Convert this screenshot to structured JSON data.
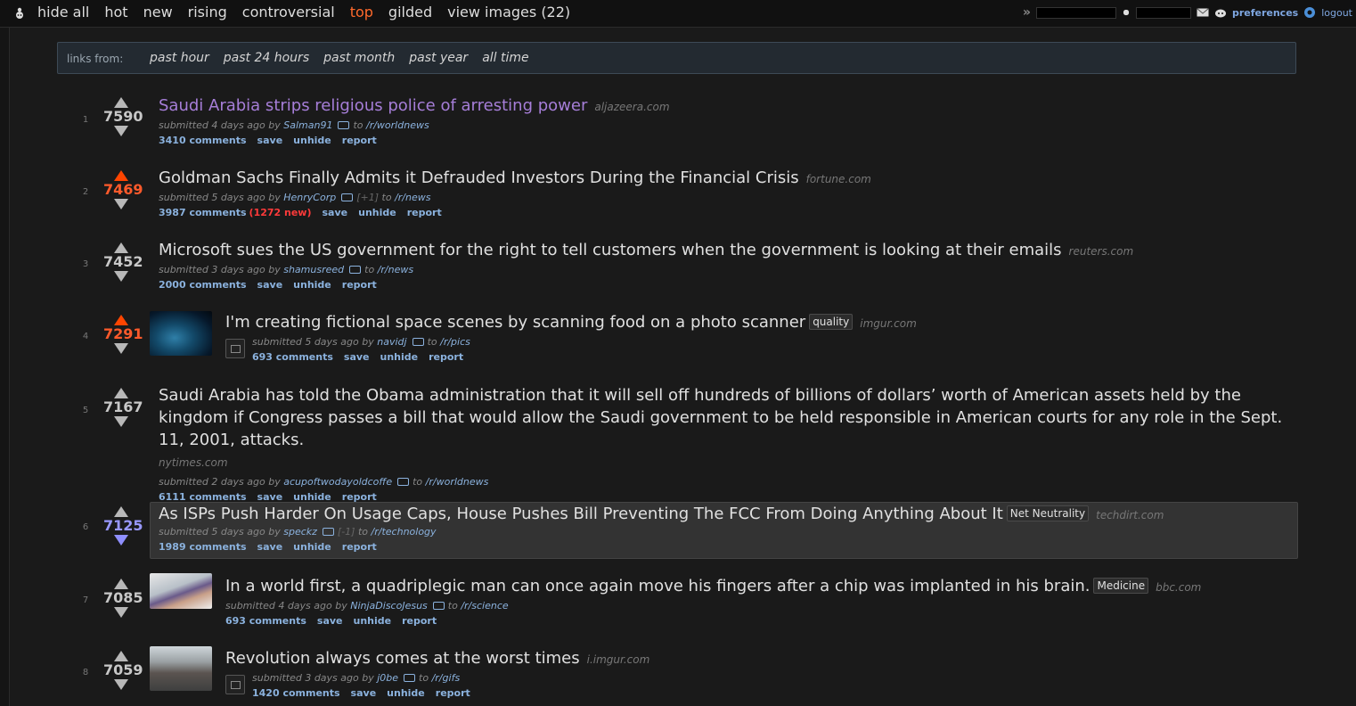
{
  "sort_tabs": [
    "hide all",
    "hot",
    "new",
    "rising",
    "controversial",
    "top",
    "gilded",
    "view images (22)"
  ],
  "active_tab": "top",
  "user": {
    "preferences": "preferences",
    "logout": "logout"
  },
  "time_filter": {
    "label": "links from:",
    "options": [
      "past hour",
      "past 24 hours",
      "past month",
      "past year",
      "all time"
    ]
  },
  "posts": [
    {
      "rank": "1",
      "score": "7590",
      "title": "Saudi Arabia strips religious police of arresting power",
      "domain": "aljazeera.com",
      "submitted": "submitted 4 days ago by",
      "author": "Salman91",
      "to": "to",
      "sub": "/r/worldnews",
      "comments": "3410 comments",
      "save": "save",
      "unhide": "unhide",
      "report": "report"
    },
    {
      "rank": "2",
      "score": "7469",
      "title": "Goldman Sachs Finally Admits it Defrauded Investors During the Financial Crisis",
      "domain": "fortune.com",
      "submitted": "submitted 5 days ago by",
      "author": "HenryCorp",
      "karma": "[+1]",
      "to": "to",
      "sub": "/r/news",
      "comments": "3987 comments",
      "new_comments": "(1272 new)",
      "save": "save",
      "unhide": "unhide",
      "report": "report"
    },
    {
      "rank": "3",
      "score": "7452",
      "title": "Microsoft sues the US government for the right to tell customers when the government is looking at their emails",
      "domain": "reuters.com",
      "submitted": "submitted 3 days ago by",
      "author": "shamusreed",
      "to": "to",
      "sub": "/r/news",
      "comments": "2000 comments",
      "save": "save",
      "unhide": "unhide",
      "report": "report"
    },
    {
      "rank": "4",
      "score": "7291",
      "title": "I'm creating fictional space scenes by scanning food on a photo scanner",
      "flair": "quality",
      "domain": "imgur.com",
      "submitted": "submitted 5 days ago by",
      "author": "navidj",
      "to": "to",
      "sub": "/r/pics",
      "comments": "693 comments",
      "save": "save",
      "unhide": "unhide",
      "report": "report"
    },
    {
      "rank": "5",
      "score": "7167",
      "title": "Saudi Arabia has told the Obama administration that it will sell off hundreds of billions of dollars’ worth of American assets held by the kingdom if Congress passes a bill that would allow the Saudi government to be held responsible in American courts for any role in the Sept. 11, 2001, attacks.",
      "domain": "nytimes.com",
      "submitted": "submitted 2 days ago by",
      "author": "acupoftwodayoldcoffe",
      "to": "to",
      "sub": "/r/worldnews",
      "comments": "6111 comments",
      "save": "save",
      "unhide": "unhide",
      "report": "report"
    },
    {
      "rank": "6",
      "score": "7125",
      "title": "As ISPs Push Harder On Usage Caps, House Pushes Bill Preventing The FCC From Doing Anything About It",
      "flair": "Net Neutrality",
      "domain": "techdirt.com",
      "submitted": "submitted 5 days ago by",
      "author": "speckz",
      "karma": "[-1]",
      "to": "to",
      "sub": "/r/technology",
      "comments": "1989 comments",
      "save": "save",
      "unhide": "unhide",
      "report": "report"
    },
    {
      "rank": "7",
      "score": "7085",
      "title": "In a world first, a quadriplegic man can once again move his fingers after a chip was implanted in his brain.",
      "flair": "Medicine",
      "domain": "bbc.com",
      "submitted": "submitted 4 days ago by",
      "author": "NinjaDiscoJesus",
      "to": "to",
      "sub": "/r/science",
      "comments": "693 comments",
      "save": "save",
      "unhide": "unhide",
      "report": "report"
    },
    {
      "rank": "8",
      "score": "7059",
      "title": "Revolution always comes at the worst times",
      "domain": "i.imgur.com",
      "submitted": "submitted 3 days ago by",
      "author": "j0be",
      "to": "to",
      "sub": "/r/gifs",
      "comments": "1420 comments",
      "save": "save",
      "unhide": "unhide",
      "report": "report"
    }
  ],
  "colors": {
    "active_tab": "#ff6a2c",
    "upvoted": "#ff4500",
    "downvoted": "#8f8fff",
    "visited": "#a67ed8",
    "link": "#8bb2de"
  }
}
